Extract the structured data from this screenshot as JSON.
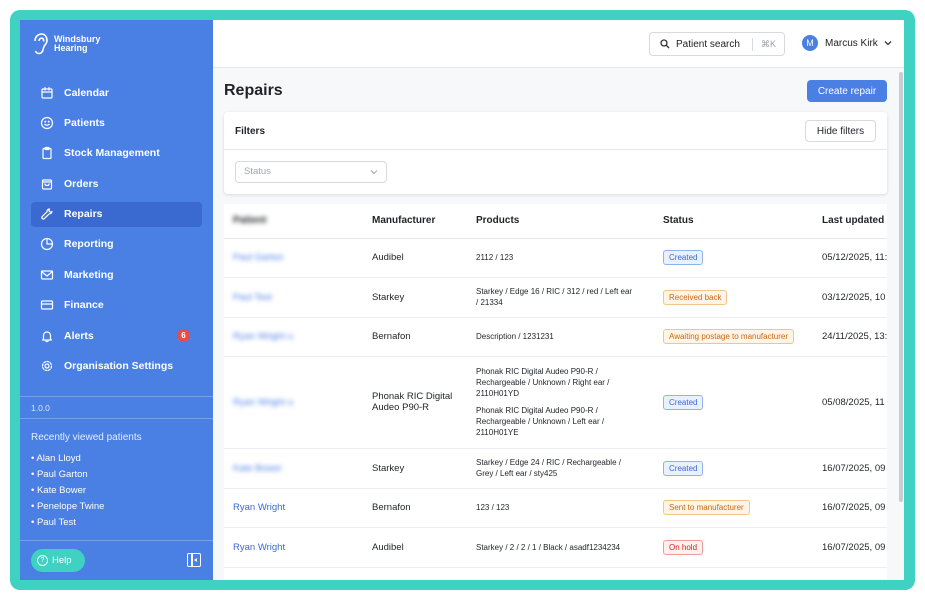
{
  "brand": {
    "line1": "Windsbury",
    "line2": "Hearing"
  },
  "nav": [
    {
      "label": "Calendar",
      "icon": "calendar-icon"
    },
    {
      "label": "Patients",
      "icon": "smile-icon"
    },
    {
      "label": "Stock Management",
      "icon": "clipboard-icon"
    },
    {
      "label": "Orders",
      "icon": "bag-icon"
    },
    {
      "label": "Repairs",
      "icon": "wrench-icon"
    },
    {
      "label": "Reporting",
      "icon": "pie-chart-icon"
    },
    {
      "label": "Marketing",
      "icon": "mail-icon"
    },
    {
      "label": "Finance",
      "icon": "credit-card-icon"
    },
    {
      "label": "Alerts",
      "icon": "bell-icon",
      "badge": "6"
    },
    {
      "label": "Organisation Settings",
      "icon": "gear-icon"
    }
  ],
  "version": "1.0.0",
  "recent": {
    "title": "Recently viewed patients",
    "items": [
      "• Alan Lloyd",
      "• Paul Garton",
      "• Kate Bower",
      "• Penelope Twine",
      "• Paul Test"
    ]
  },
  "help_label": "Help",
  "topbar": {
    "search_label": "Patient search",
    "search_shortcut": "⌘K",
    "user_initial": "M",
    "user_name": "Marcus Kirk"
  },
  "page": {
    "title": "Repairs",
    "create_label": "Create repair"
  },
  "filters": {
    "title": "Filters",
    "hide_label": "Hide filters",
    "status_placeholder": "Status"
  },
  "table": {
    "headers": [
      "Patient",
      "Manufacturer",
      "Products",
      "Status",
      "Last updated"
    ],
    "rows": [
      {
        "patient": "Paul Garton",
        "blurred": true,
        "manufacturer": "Audibel",
        "products": [
          "2112 / 123"
        ],
        "status": "Created",
        "status_color": "blue",
        "updated": "05/12/2025, 11:"
      },
      {
        "patient": "Paul Test",
        "blurred": true,
        "manufacturer": "Starkey",
        "products": [
          "Starkey / Edge 16 / RIC / 312 / red / Left ear",
          "/ 21334"
        ],
        "status": "Received back",
        "status_color": "orange",
        "updated": "03/12/2025, 10"
      },
      {
        "patient": "Ryan Wright u",
        "blurred": true,
        "manufacturer": "Bernafon",
        "products": [
          "Description / 1231231"
        ],
        "status": "Awaiting postage to manufacturer",
        "status_color": "orange",
        "updated": "24/11/2025, 13:"
      },
      {
        "patient": "Ryan Wright u",
        "blurred": true,
        "manufacturer": "Phonak RIC Digital Audeo P90-R",
        "products": [
          "Phonak RIC Digital Audeo P90-R /",
          "Rechargeable / Unknown / Right ear /",
          "2110H01YD",
          "",
          "Phonak RIC Digital Audeo P90-R /",
          "Rechargeable / Unknown / Left ear /",
          "2110H01YE"
        ],
        "status": "Created",
        "status_color": "blue",
        "updated": "05/08/2025, 11"
      },
      {
        "patient": "Kate Bower",
        "blurred": true,
        "manufacturer": "Starkey",
        "products": [
          "Starkey / Edge 24 / RIC / Rechargeable /",
          "Grey / Left ear / sty425"
        ],
        "status": "Created",
        "status_color": "blue",
        "updated": "16/07/2025, 09"
      },
      {
        "patient": "Ryan Wright",
        "blurred": false,
        "manufacturer": "Bernafon",
        "products": [
          "123 / 123"
        ],
        "status": "Sent to manufacturer",
        "status_color": "orange",
        "updated": "16/07/2025, 09"
      },
      {
        "patient": "Ryan Wright",
        "blurred": false,
        "manufacturer": "Audibel",
        "products": [
          "Starkey / 2 / 2 / 1 / Black / asadf1234234"
        ],
        "status": "On hold",
        "status_color": "red",
        "updated": "16/07/2025, 09"
      }
    ]
  },
  "colors": {
    "frame": "#3fd1c1",
    "sidebar": "#4a7fe4",
    "primary_button": "#4a7fe4",
    "alert_badge": "#e74c4c"
  }
}
